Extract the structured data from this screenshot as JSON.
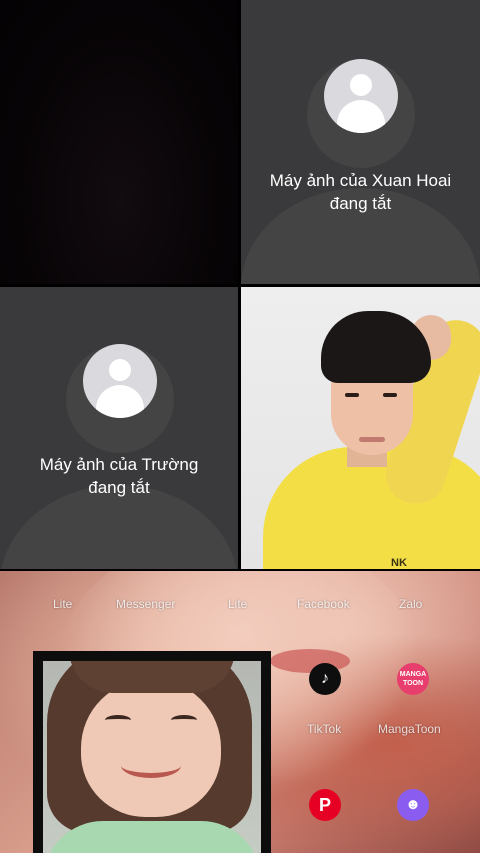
{
  "participants": {
    "xuan_hoai": {
      "status_line1": "Máy ảnh của Xuan Hoai",
      "status_line2": "đang tắt"
    },
    "truong": {
      "status_line1": "Máy ảnh của Trường",
      "status_line2": "đang tắt"
    }
  },
  "boy_video": {
    "shirt_print": "NK"
  },
  "shared_screen": {
    "labels": [
      "Lite",
      "Messenger",
      "Lite",
      "Facebook",
      "Zalo"
    ],
    "apps": [
      {
        "name": "TikTok",
        "icon": "tiktok-icon",
        "glyph": "♪"
      },
      {
        "name": "MangaToon",
        "icon": "mangatoon-icon",
        "glyph": "MANGA TOON"
      },
      {
        "name": "",
        "icon": "pinterest-icon",
        "glyph": "P"
      },
      {
        "name": "",
        "icon": "discord-icon",
        "glyph": "☻"
      }
    ]
  },
  "colors": {
    "tile_bg": "#3a3a3c",
    "avatar": "#d9d9de"
  }
}
